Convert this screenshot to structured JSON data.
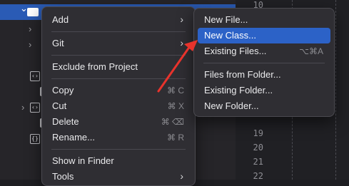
{
  "navigator": {
    "disclosure_open": "⌄",
    "disclosure_closed": "›"
  },
  "gutter": {
    "line_numbers": [
      "10",
      "19",
      "20",
      "21",
      "22"
    ]
  },
  "context_menu": {
    "items": [
      {
        "label": "Add",
        "chevron": "›"
      },
      {
        "label": "Git",
        "chevron": "›"
      },
      {
        "label": "Exclude from Project"
      },
      {
        "label": "Copy",
        "shortcut": "⌘ C"
      },
      {
        "label": "Cut",
        "shortcut": "⌘ X"
      },
      {
        "label": "Delete",
        "shortcut": "⌘ ⌫"
      },
      {
        "label": "Rename...",
        "shortcut": "⌘ R"
      },
      {
        "label": "Show in Finder"
      },
      {
        "label": "Tools",
        "chevron": "›"
      }
    ]
  },
  "add_submenu": {
    "items": [
      {
        "label": "New File..."
      },
      {
        "label": "New Class...",
        "highlighted": true
      },
      {
        "label": "Existing Files...",
        "shortcut": "⌥⌘A"
      },
      {
        "label": "Files from Folder..."
      },
      {
        "label": "Existing Folder..."
      },
      {
        "label": "New Folder..."
      }
    ]
  },
  "colors": {
    "highlight": "#2c62c7",
    "annotation_arrow": "#e8332c",
    "menu_background": "#2f2e33"
  }
}
